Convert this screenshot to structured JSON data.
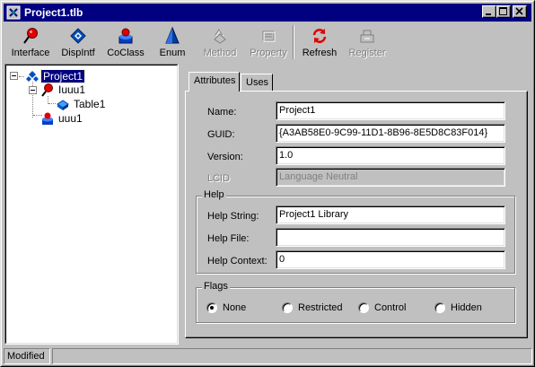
{
  "window": {
    "title": "Project1.tlb",
    "icon": "typelib-app-icon"
  },
  "titlebar_buttons": [
    "minimize",
    "maximize",
    "close"
  ],
  "toolbar": {
    "items": [
      {
        "label": "Interface",
        "icon": "interface-icon",
        "enabled": true
      },
      {
        "label": "DispIntf",
        "icon": "dispintf-icon",
        "enabled": true
      },
      {
        "label": "CoClass",
        "icon": "coclass-icon",
        "enabled": true
      },
      {
        "label": "Enum",
        "icon": "enum-icon",
        "enabled": true
      },
      {
        "label": "Method",
        "icon": "method-icon",
        "enabled": false
      },
      {
        "label": "Property",
        "icon": "property-icon",
        "enabled": false
      },
      {
        "label": "Refresh",
        "icon": "refresh-icon",
        "enabled": true
      },
      {
        "label": "Register",
        "icon": "register-icon",
        "enabled": false
      }
    ]
  },
  "tree": {
    "root": {
      "label": "Project1",
      "icon": "typelib-icon",
      "selected": true
    },
    "children": [
      {
        "label": "Iuuu1",
        "icon": "interface-icon"
      },
      {
        "label": "Table1",
        "icon": "method-icon"
      },
      {
        "label": "uuu1",
        "icon": "coclass-icon"
      }
    ]
  },
  "tabs": [
    {
      "label": "Attributes",
      "active": true
    },
    {
      "label": "Uses",
      "active": false
    }
  ],
  "attributes": {
    "name_label": "Name:",
    "name_value": "Project1",
    "guid_label": "GUID:",
    "guid_value": "{A3AB58E0-9C99-11D1-8B96-8E5D8C83F014}",
    "version_label": "Version:",
    "version_value": "1.0",
    "lcid_label": "LCID",
    "lcid_value": "Language Neutral"
  },
  "help": {
    "group_title": "Help",
    "string_label": "Help String:",
    "string_value": "Project1 Library",
    "file_label": "Help File:",
    "file_value": "",
    "context_label": "Help Context:",
    "context_value": "0"
  },
  "flags": {
    "group_title": "Flags",
    "options": [
      {
        "label": "None",
        "checked": true
      },
      {
        "label": "Restricted",
        "checked": false
      },
      {
        "label": "Control",
        "checked": false
      },
      {
        "label": "Hidden",
        "checked": false
      }
    ]
  },
  "status": {
    "text": "Modified",
    "secondary": ""
  },
  "colors": {
    "titlebar": "#000080",
    "face": "#c0c0c0",
    "selection": "#000080"
  }
}
